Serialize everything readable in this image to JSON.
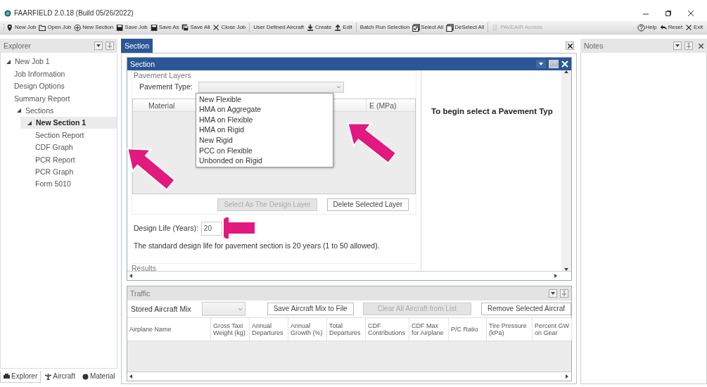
{
  "window": {
    "title": "FAARFIELD 2.0.18 (Build 05/26/2022)"
  },
  "toolbar": [
    {
      "label": "New Job",
      "disabled": false
    },
    {
      "label": "Open Job",
      "disabled": false
    },
    {
      "label": "New Section",
      "disabled": false
    },
    {
      "label": "Save Job",
      "disabled": false
    },
    {
      "label": "Save As",
      "disabled": false
    },
    {
      "label": "Save All",
      "disabled": false
    },
    {
      "label": "Close Job",
      "disabled": false
    },
    {
      "label": "User Defined Aircraft",
      "disabled": false
    },
    {
      "label": "Create",
      "disabled": false
    },
    {
      "label": "Edit",
      "disabled": false
    },
    {
      "label": "Batch Run Selection",
      "disabled": false
    },
    {
      "label": "Select All",
      "disabled": false
    },
    {
      "label": "DeSelect All",
      "disabled": false
    },
    {
      "label": "PAVEAIR Access",
      "disabled": true
    }
  ],
  "toolbar_right": [
    {
      "label": "Help"
    },
    {
      "label": "Reset"
    },
    {
      "label": "Exit"
    }
  ],
  "explorer": {
    "title": "Explorer",
    "tree": [
      {
        "label": "New Job 1",
        "selected": false,
        "expanded": true,
        "children": [
          {
            "label": "Job Information",
            "selected": false
          },
          {
            "label": "Design Options",
            "selected": false
          },
          {
            "label": "Summary Report",
            "selected": false
          },
          {
            "label": "Sections",
            "selected": false,
            "expanded": true,
            "children": [
              {
                "label": "New Section 1",
                "selected": true,
                "expanded": true,
                "children": [
                  {
                    "label": "Section Report",
                    "selected": false
                  },
                  {
                    "label": "CDF Graph",
                    "selected": false
                  },
                  {
                    "label": "PCR Report",
                    "selected": false
                  },
                  {
                    "label": "PCR Graph",
                    "selected": false
                  },
                  {
                    "label": "Form 5010",
                    "selected": false
                  }
                ]
              }
            ]
          }
        ]
      }
    ],
    "tabs": [
      {
        "label": "Explorer",
        "selected": true
      },
      {
        "label": "Aircraft",
        "selected": false
      },
      {
        "label": "Material",
        "selected": false
      }
    ]
  },
  "document_tabs": [
    {
      "label": "Section",
      "selected": true
    }
  ],
  "section": {
    "title": "Section",
    "group": "Pavement Layers",
    "pavement_type_label": "Pavement Type:",
    "pavement_type": {
      "expanded": true,
      "options": [
        "New Flexible",
        "HMA on Aggregate",
        "HMA on Flexible",
        "HMA on Rigid",
        "New Rigid",
        "PCC on Flexible",
        "Unbonded on Rigid"
      ]
    },
    "layer_columns": [
      "Material",
      "E (MPa)"
    ],
    "buttons": [
      {
        "label": "Select As The Design Layer",
        "disabled": true
      },
      {
        "label": "Delete Selected Layer",
        "disabled": false
      }
    ],
    "design_life_label": "Design Life (Years):",
    "design_life": "20",
    "note": "The standard design life for pavement section is 20 years (1 to 50 allowed).",
    "results_label": "Results",
    "prompt": "To begin select a Pavement Typ"
  },
  "traffic": {
    "title": "Traffic",
    "stored_mix_label": "Stored Aircraft Mix",
    "buttons": [
      {
        "label": "Save Aircraft Mix to File",
        "disabled": false
      },
      {
        "label": "Clear All Aircraft from List",
        "disabled": true
      },
      {
        "label": "Remove Selected Aircraf",
        "disabled": false
      }
    ],
    "columns": [
      "Airplane Name",
      "Gross Taxi Weight (kg)",
      "Annual Departures",
      "Annual Growth (%)",
      "Total Departures",
      "CDF Contributions",
      "CDF Max for Airplane",
      "P/C Ratio",
      "Tire Pressure (kPa)",
      "Percent GW on Gear"
    ]
  },
  "notes": {
    "title": "Notes"
  }
}
